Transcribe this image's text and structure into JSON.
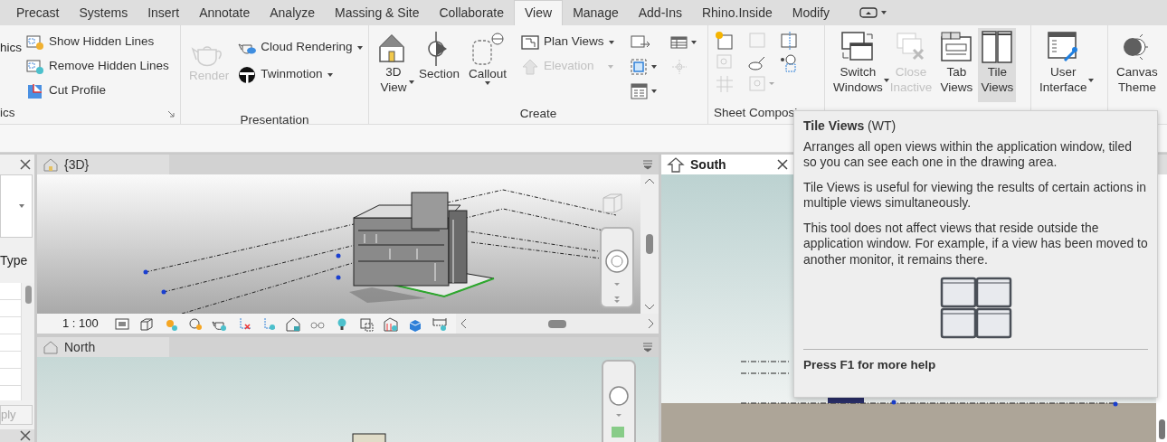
{
  "tabs": [
    {
      "label": "Precast",
      "selected": false
    },
    {
      "label": "Systems",
      "selected": false
    },
    {
      "label": "Insert",
      "selected": false
    },
    {
      "label": "Annotate",
      "selected": false
    },
    {
      "label": "Analyze",
      "selected": false
    },
    {
      "label": "Massing & Site",
      "selected": false
    },
    {
      "label": "Collaborate",
      "selected": false
    },
    {
      "label": "View",
      "selected": true
    },
    {
      "label": "Manage",
      "selected": false
    },
    {
      "label": "Add-Ins",
      "selected": false
    },
    {
      "label": "Rhino.Inside",
      "selected": false
    },
    {
      "label": "Modify",
      "selected": false
    }
  ],
  "ribbon": {
    "graphics": {
      "label": "ics",
      "commands": [
        {
          "label": "hics"
        },
        {
          "label": "Show Hidden Lines"
        },
        {
          "label": "Remove Hidden Lines"
        },
        {
          "label": "Cut Profile"
        }
      ]
    },
    "presentation": {
      "label": "Presentation",
      "commands": [
        {
          "label": "Render",
          "disabled": true
        },
        {
          "label": "Cloud Rendering",
          "disabled": false
        },
        {
          "label": "Twinmotion",
          "disabled": false
        }
      ]
    },
    "create": {
      "label": "Create",
      "commands": [
        {
          "label": "3D View",
          "disabled": false
        },
        {
          "label": "Section",
          "disabled": false
        },
        {
          "label": "Callout",
          "disabled": false
        },
        {
          "label": "Plan Views",
          "disabled": false
        },
        {
          "label": "Elevation",
          "disabled": true
        }
      ]
    },
    "sheet_composition": {
      "label": "Sheet Composi"
    },
    "windows": {
      "commands": [
        {
          "label": "Switch Windows",
          "disabled": false,
          "selected": false
        },
        {
          "label": "Close Inactive",
          "disabled": true,
          "selected": false
        },
        {
          "label": "Tab Views",
          "disabled": false,
          "selected": false
        },
        {
          "label": "Tile Views",
          "disabled": false,
          "selected": true
        }
      ]
    },
    "user_interface": {
      "label": "User Interface"
    },
    "canvas_theme": {
      "label": "Canvas Theme"
    }
  },
  "properties": {
    "type_label": "Type",
    "apply_button": "ply"
  },
  "views": [
    {
      "title": "{3D}",
      "scale": "1 : 100",
      "active": false
    },
    {
      "title": "North",
      "active": false
    },
    {
      "title": "South",
      "active": true
    }
  ],
  "tooltip": {
    "title": "Tile Views",
    "shortcut": "(WT)",
    "paragraphs": [
      "Arranges all open views within the application window, tiled so you can see each one in the drawing area.",
      "Tile Views is useful for viewing the results of certain actions in multiple views simultaneously.",
      "This tool does not affect views that reside outside the application window. For example, if a view has been moved to another monitor, it remains there."
    ],
    "footer": "Press F1 for more help"
  }
}
